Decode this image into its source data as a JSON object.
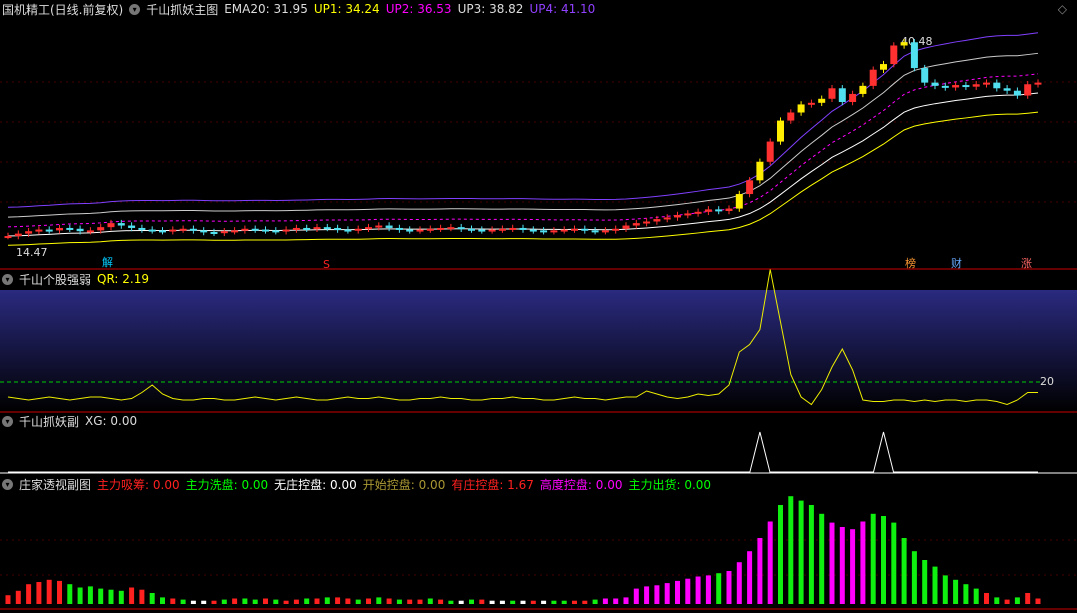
{
  "main": {
    "stock": "国机精工(日线.前复权)",
    "indicator": "千山抓妖主图",
    "ema20": "EMA20: 31.95",
    "up1": "UP1: 34.24",
    "up2": "UP2: 36.53",
    "up3": "UP3: 38.82",
    "up4": "UP4: 41.10",
    "high_label": "40.48",
    "low_label": "14.47",
    "markers": [
      "解",
      "S",
      "榜",
      "财",
      "涨"
    ]
  },
  "panel2": {
    "title": "千山个股强弱",
    "value": "QR: 2.19",
    "level_label": "20"
  },
  "panel3": {
    "title": "千山抓妖副",
    "value": "XG: 0.00"
  },
  "panel4": {
    "title": "庄家透视副图",
    "items": [
      {
        "label": "主力吸筹: 0.00",
        "color": "#ff2020"
      },
      {
        "label": "主力洗盘: 0.00",
        "color": "#00ff00"
      },
      {
        "label": "无庄控盘: 0.00",
        "color": "#ffffff"
      },
      {
        "label": "开始控盘: 0.00",
        "color": "#aa9933"
      },
      {
        "label": "有庄控盘: 1.67",
        "color": "#ff2020"
      },
      {
        "label": "高度控盘: 0.00",
        "color": "#ff00ff"
      },
      {
        "label": "主力出货: 0.00",
        "color": "#00ff00"
      }
    ]
  },
  "chart_data": {
    "type": "candlestick",
    "closes": [
      16.2,
      16.5,
      16.8,
      17.0,
      16.9,
      17.2,
      17.1,
      16.8,
      16.9,
      17.3,
      17.8,
      17.5,
      17.2,
      17.0,
      16.9,
      16.8,
      17.0,
      17.1,
      16.9,
      16.7,
      16.6,
      16.8,
      16.9,
      17.1,
      17.0,
      16.9,
      16.8,
      17.0,
      17.2,
      17.1,
      17.3,
      17.2,
      17.0,
      16.9,
      17.1,
      17.3,
      17.5,
      17.2,
      17.0,
      16.9,
      17.0,
      17.1,
      17.2,
      17.3,
      17.1,
      17.0,
      16.9,
      17.0,
      17.1,
      17.2,
      17.0,
      16.9,
      16.8,
      16.9,
      17.0,
      17.1,
      16.9,
      16.8,
      16.9,
      17.1,
      17.5,
      17.8,
      18.0,
      18.3,
      18.5,
      18.8,
      19.0,
      19.2,
      19.5,
      19.3,
      19.6,
      21.4,
      23.1,
      25.4,
      27.9,
      30.5,
      31.5,
      32.5,
      32.7,
      33.2,
      34.5,
      32.8,
      33.8,
      34.8,
      36.8,
      37.5,
      39.8,
      40.2,
      37.0,
      35.2,
      34.8,
      34.6,
      34.9,
      34.7,
      35.0,
      35.2,
      34.5,
      34.2,
      33.6,
      35.0,
      35.2
    ],
    "price_range": [
      14.47,
      40.48
    ],
    "qr": [
      10,
      9,
      8,
      9,
      10,
      9,
      8,
      9,
      10,
      10,
      9,
      8,
      9,
      13,
      18,
      12,
      9,
      8,
      8,
      9,
      9,
      8,
      8,
      9,
      10,
      9,
      8,
      9,
      10,
      9,
      8,
      8,
      9,
      10,
      9,
      9,
      10,
      9,
      8,
      8,
      9,
      9,
      10,
      9,
      9,
      8,
      8,
      9,
      9,
      10,
      9,
      9,
      8,
      8,
      9,
      10,
      9,
      9,
      8,
      9,
      10,
      10,
      14,
      12,
      10,
      9,
      10,
      12,
      11,
      12,
      18,
      40,
      45,
      55,
      95,
      60,
      25,
      10,
      5,
      15,
      30,
      42,
      28,
      8,
      7,
      7,
      8,
      8,
      7,
      8,
      7,
      8,
      8,
      7,
      8,
      8,
      7,
      5,
      8,
      13,
      13
    ],
    "qr_level": 20,
    "xg": [
      0,
      0,
      0,
      0,
      0,
      0,
      0,
      0,
      0,
      0,
      0,
      0,
      0,
      0,
      0,
      0,
      0,
      0,
      0,
      0,
      0,
      0,
      0,
      0,
      0,
      0,
      0,
      0,
      0,
      0,
      0,
      0,
      0,
      0,
      0,
      0,
      0,
      0,
      0,
      0,
      0,
      0,
      0,
      0,
      0,
      0,
      0,
      0,
      0,
      0,
      0,
      0,
      0,
      0,
      0,
      0,
      0,
      0,
      0,
      0,
      0,
      0,
      0,
      0,
      0,
      0,
      0,
      0,
      0,
      0,
      0,
      0,
      0,
      1,
      0,
      0,
      0,
      0,
      0,
      0,
      0,
      0,
      0,
      0,
      0,
      1,
      0,
      0,
      0,
      0,
      0,
      0,
      0,
      0,
      0,
      0,
      0,
      0,
      0,
      0,
      0
    ],
    "zj_values": [
      0.8,
      1.2,
      1.8,
      2.0,
      2.2,
      2.1,
      1.8,
      1.5,
      1.6,
      1.4,
      1.3,
      1.2,
      1.5,
      1.3,
      1.0,
      0.6,
      0.5,
      0.4,
      0.3,
      0.3,
      0.3,
      0.4,
      0.5,
      0.5,
      0.4,
      0.5,
      0.4,
      0.3,
      0.4,
      0.5,
      0.5,
      0.6,
      0.6,
      0.5,
      0.4,
      0.5,
      0.6,
      0.5,
      0.4,
      0.4,
      0.4,
      0.5,
      0.4,
      0.3,
      0.3,
      0.4,
      0.4,
      0.3,
      0.3,
      0.3,
      0.3,
      0.3,
      0.3,
      0.3,
      0.3,
      0.3,
      0.3,
      0.4,
      0.5,
      0.5,
      0.6,
      1.4,
      1.6,
      1.7,
      1.9,
      2.1,
      2.3,
      2.5,
      2.6,
      2.8,
      3.0,
      3.8,
      4.8,
      6.0,
      7.5,
      9.0,
      9.8,
      9.4,
      9.0,
      8.2,
      7.4,
      7.0,
      6.8,
      7.5,
      8.2,
      8.0,
      7.4,
      6.0,
      4.8,
      4.0,
      3.4,
      2.6,
      2.2,
      1.8,
      1.4,
      1.0,
      0.6,
      0.4,
      0.6,
      1.0,
      0.5
    ],
    "zj_types": "rrrrrrggggggrrggrgwwrgrggrgrrgrgrrgrgrgrrgrgwgrwwgwrwggrrgmmmmmmmmmmmgmmmmmgggggmmmmgggggggggggrgrg"
  }
}
